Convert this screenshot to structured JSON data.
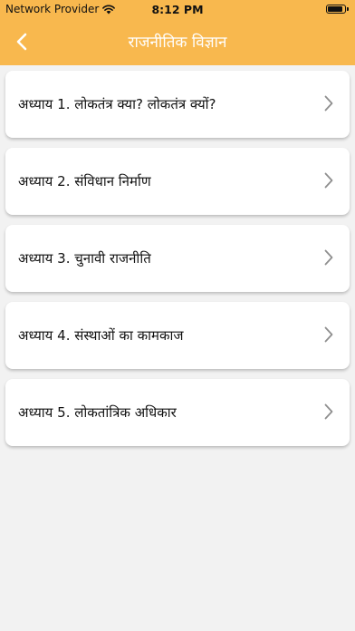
{
  "status_bar": {
    "carrier": "Network Provider",
    "time": "8:12 PM"
  },
  "header": {
    "title": "राजनीतिक विज्ञान",
    "back_icon": "chevron-left-icon",
    "background_color": "#f8b84e"
  },
  "chapters": [
    {
      "label": "अध्याय 1. लोकतंत्र क्या? लोकतंत्र क्यों?"
    },
    {
      "label": "अध्याय 2. संविधान निर्माण"
    },
    {
      "label": "अध्याय 3. चुनावी राजनीति"
    },
    {
      "label": "अध्याय 4. संस्थाओं का कामकाज"
    },
    {
      "label": "अध्याय 5. लोकतांत्रिक अधिकार"
    }
  ]
}
